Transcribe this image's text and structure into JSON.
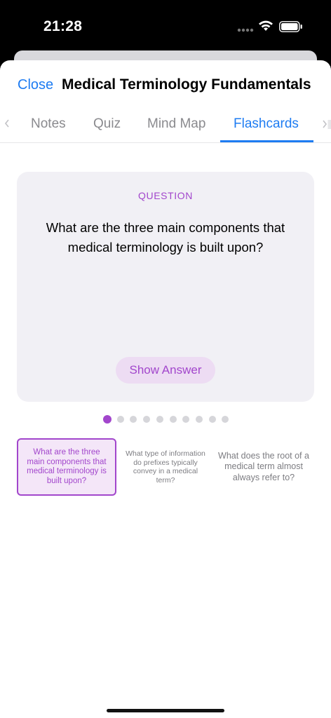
{
  "status": {
    "time": "21:28"
  },
  "nav": {
    "close_label": "Close",
    "title": "Medical Terminology Fundamentals"
  },
  "tabs": [
    {
      "label": "Notes",
      "active": false
    },
    {
      "label": "Quiz",
      "active": false
    },
    {
      "label": "Mind Map",
      "active": false
    },
    {
      "label": "Flashcards",
      "active": true
    }
  ],
  "card": {
    "label": "QUESTION",
    "question": "What are the three main components that medical terminology is built upon?",
    "show_answer_label": "Show Answer"
  },
  "pagination": {
    "total": 10,
    "current": 1
  },
  "thumbnails": [
    {
      "text": "What are the three main components that medical terminology is built upon?",
      "active": true
    },
    {
      "text": "What type of information do prefixes typically convey in a medical term?",
      "active": false
    },
    {
      "text": "What does the root of a medical term almost always refer to?",
      "active": false
    }
  ],
  "colors": {
    "accent": "#a246cc",
    "link": "#1e7cf2"
  }
}
